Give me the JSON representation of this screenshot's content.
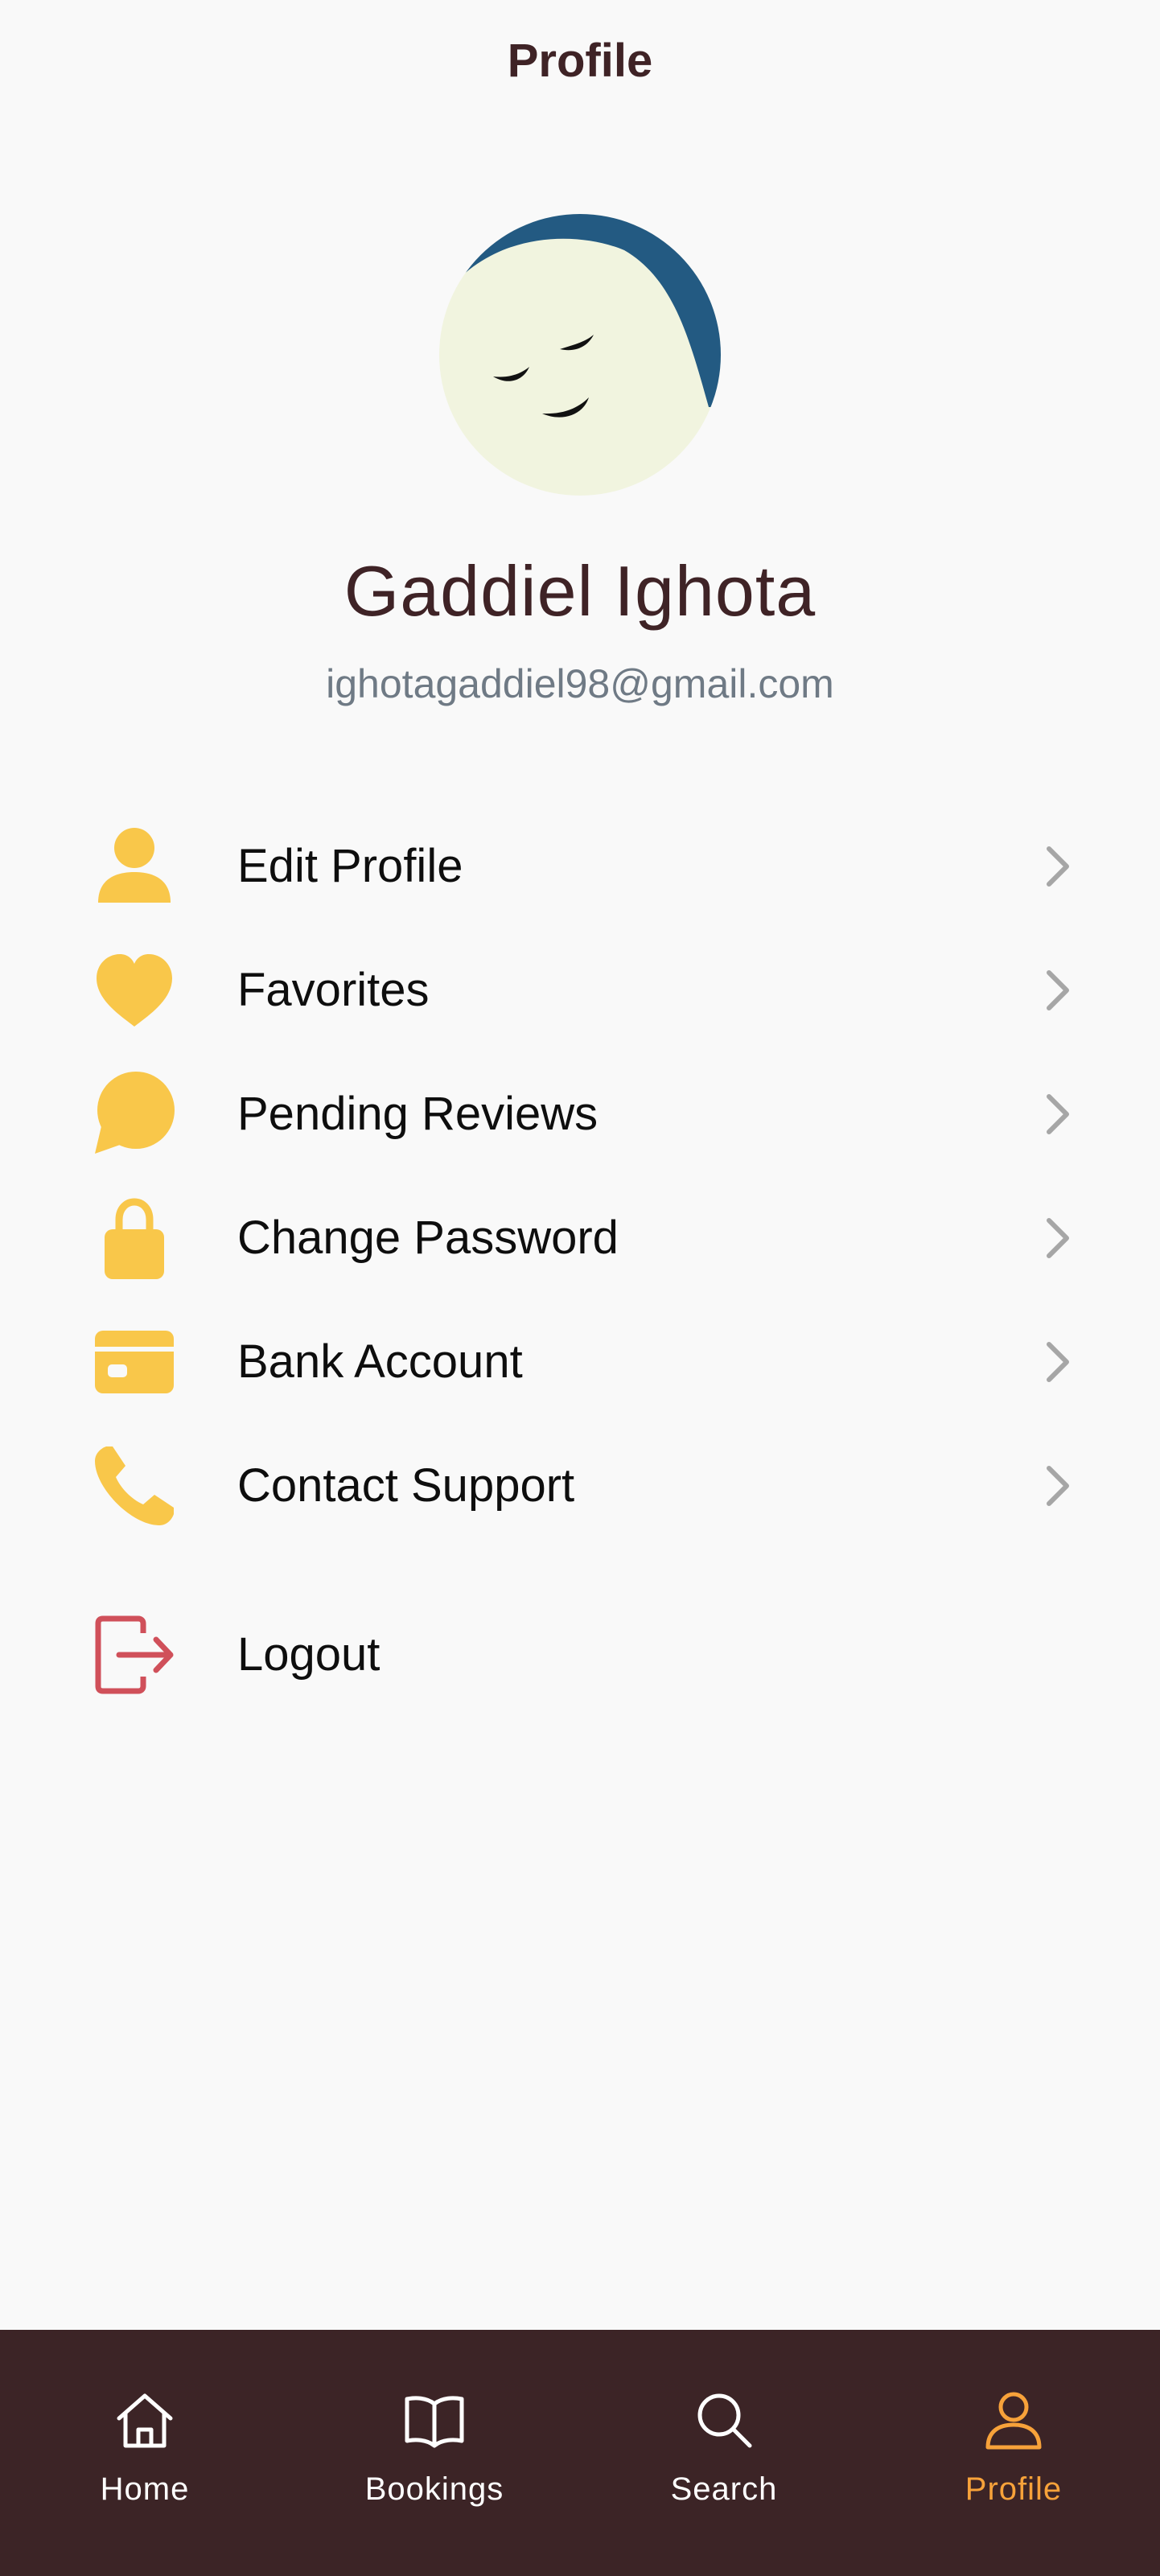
{
  "header": {
    "title": "Profile"
  },
  "profile": {
    "name": "Gaddiel Ighota",
    "email": "ighotagaddiel98@gmail.com"
  },
  "menu": {
    "items": [
      {
        "label": "Edit Profile",
        "icon": "person-icon"
      },
      {
        "label": "Favorites",
        "icon": "heart-icon"
      },
      {
        "label": "Pending Reviews",
        "icon": "chat-bubble-icon"
      },
      {
        "label": "Change Password",
        "icon": "lock-icon"
      },
      {
        "label": "Bank Account",
        "icon": "credit-card-icon"
      },
      {
        "label": "Contact Support",
        "icon": "phone-icon"
      }
    ],
    "logout_label": "Logout"
  },
  "bottom_nav": {
    "items": [
      {
        "label": "Home",
        "icon": "home-icon"
      },
      {
        "label": "Bookings",
        "icon": "book-icon"
      },
      {
        "label": "Search",
        "icon": "search-icon"
      },
      {
        "label": "Profile",
        "icon": "person-outline-icon"
      }
    ],
    "active": "Profile"
  },
  "colors": {
    "background": "#f9f9f9",
    "title": "#3f2326",
    "email": "#6f7a85",
    "icon_accent": "#f9c74a",
    "logout_accent": "#d0505a",
    "nav_background": "#3c2426",
    "nav_active": "#f7a23a",
    "avatar_face": "#f1f4df",
    "avatar_hair": "#235a82"
  }
}
